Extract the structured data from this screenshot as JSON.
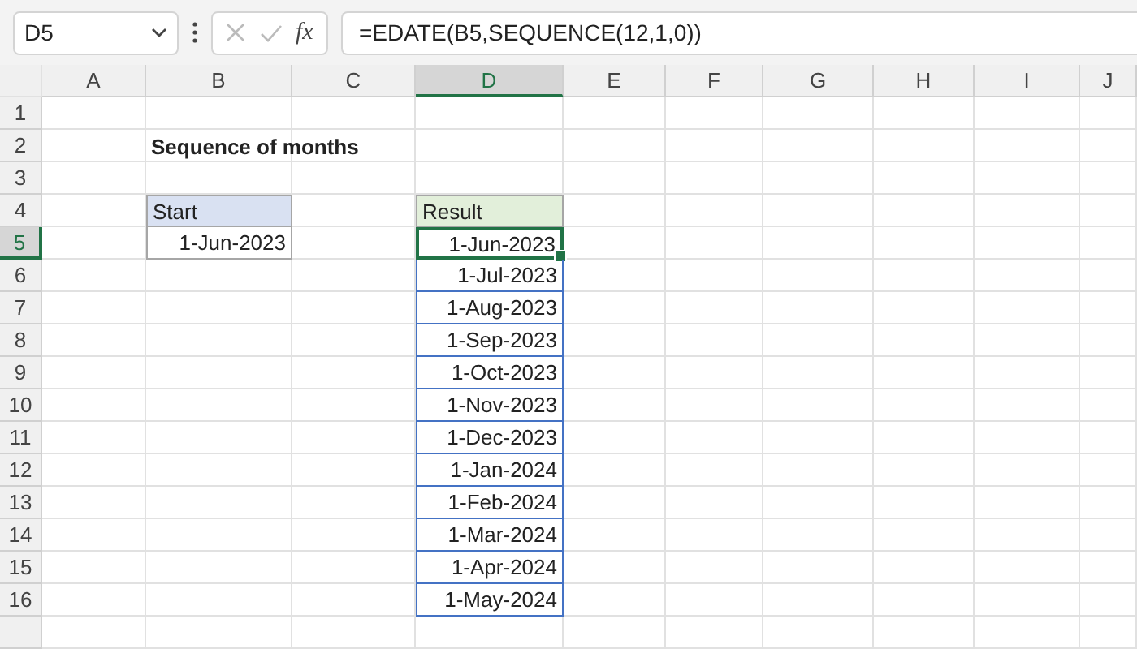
{
  "name_box": {
    "value": "D5"
  },
  "formula_bar": {
    "fx_label": "fx",
    "formula": "=EDATE(B5,SEQUENCE(12,1,0))"
  },
  "columns": [
    {
      "label": "A",
      "selected": false
    },
    {
      "label": "B",
      "selected": false
    },
    {
      "label": "C",
      "selected": false
    },
    {
      "label": "D",
      "selected": true
    },
    {
      "label": "E",
      "selected": false
    },
    {
      "label": "F",
      "selected": false
    },
    {
      "label": "G",
      "selected": false
    },
    {
      "label": "H",
      "selected": false
    },
    {
      "label": "I",
      "selected": false
    },
    {
      "label": "J",
      "selected": false
    }
  ],
  "rows": [
    {
      "label": "1",
      "selected": false
    },
    {
      "label": "2",
      "selected": false
    },
    {
      "label": "3",
      "selected": false
    },
    {
      "label": "4",
      "selected": false
    },
    {
      "label": "5",
      "selected": true
    },
    {
      "label": "6",
      "selected": false
    },
    {
      "label": "7",
      "selected": false
    },
    {
      "label": "8",
      "selected": false
    },
    {
      "label": "9",
      "selected": false
    },
    {
      "label": "10",
      "selected": false
    },
    {
      "label": "11",
      "selected": false
    },
    {
      "label": "12",
      "selected": false
    },
    {
      "label": "13",
      "selected": false
    },
    {
      "label": "14",
      "selected": false
    },
    {
      "label": "15",
      "selected": false
    },
    {
      "label": "16",
      "selected": false
    }
  ],
  "title": "Sequence of months",
  "start": {
    "header": "Start",
    "value": "1-Jun-2023"
  },
  "result": {
    "header": "Result",
    "values": [
      {
        "text": "1-Jun-2023",
        "selected": true
      },
      {
        "text": "1-Jul-2023",
        "selected": false
      },
      {
        "text": "1-Aug-2023",
        "selected": false
      },
      {
        "text": "1-Sep-2023",
        "selected": false
      },
      {
        "text": "1-Oct-2023",
        "selected": false
      },
      {
        "text": "1-Nov-2023",
        "selected": false
      },
      {
        "text": "1-Dec-2023",
        "selected": false
      },
      {
        "text": "1-Jan-2024",
        "selected": false
      },
      {
        "text": "1-Feb-2024",
        "selected": false
      },
      {
        "text": "1-Mar-2024",
        "selected": false
      },
      {
        "text": "1-Apr-2024",
        "selected": false
      },
      {
        "text": "1-May-2024",
        "selected": false
      }
    ]
  }
}
